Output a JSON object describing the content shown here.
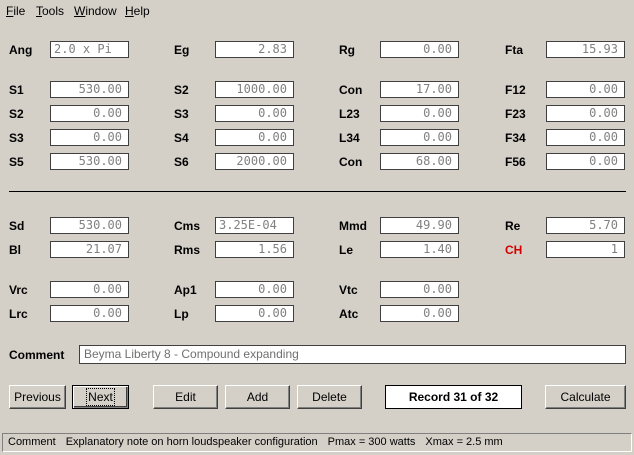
{
  "menu": [
    "File",
    "Tools",
    "Window",
    "Help"
  ],
  "fields": {
    "ang": {
      "label": "Ang",
      "value": "2.0 x Pi"
    },
    "eg": {
      "label": "Eg",
      "value": "2.83"
    },
    "rg": {
      "label": "Rg",
      "value": "0.00"
    },
    "fta": {
      "label": "Fta",
      "value": "15.93"
    },
    "s1": {
      "label": "S1",
      "value": "530.00"
    },
    "s2a": {
      "label": "S2",
      "value": "1000.00"
    },
    "con1": {
      "label": "Con",
      "value": "17.00"
    },
    "f12": {
      "label": "F12",
      "value": "0.00"
    },
    "s2b": {
      "label": "S2",
      "value": "0.00"
    },
    "s3a": {
      "label": "S3",
      "value": "0.00"
    },
    "l23": {
      "label": "L23",
      "value": "0.00"
    },
    "f23": {
      "label": "F23",
      "value": "0.00"
    },
    "s3b": {
      "label": "S3",
      "value": "0.00"
    },
    "s4": {
      "label": "S4",
      "value": "0.00"
    },
    "l34": {
      "label": "L34",
      "value": "0.00"
    },
    "f34": {
      "label": "F34",
      "value": "0.00"
    },
    "s5": {
      "label": "S5",
      "value": "530.00"
    },
    "s6": {
      "label": "S6",
      "value": "2000.00"
    },
    "con2": {
      "label": "Con",
      "value": "68.00"
    },
    "f56": {
      "label": "F56",
      "value": "0.00"
    },
    "sd": {
      "label": "Sd",
      "value": "530.00"
    },
    "cms": {
      "label": "Cms",
      "value": "3.25E-04"
    },
    "mmd": {
      "label": "Mmd",
      "value": "49.90"
    },
    "re": {
      "label": "Re",
      "value": "5.70"
    },
    "bl": {
      "label": "Bl",
      "value": "21.07"
    },
    "rms": {
      "label": "Rms",
      "value": "1.56"
    },
    "le": {
      "label": "Le",
      "value": "1.40"
    },
    "ch": {
      "label": "CH",
      "value": "1"
    },
    "vrc": {
      "label": "Vrc",
      "value": "0.00"
    },
    "ap1": {
      "label": "Ap1",
      "value": "0.00"
    },
    "vtc": {
      "label": "Vtc",
      "value": "0.00"
    },
    "lrc": {
      "label": "Lrc",
      "value": "0.00"
    },
    "lp": {
      "label": "Lp",
      "value": "0.00"
    },
    "atc": {
      "label": "Atc",
      "value": "0.00"
    }
  },
  "comment": {
    "label": "Comment",
    "value": "Beyma Liberty 8 - Compound expanding"
  },
  "buttons": {
    "previous": "Previous",
    "next": "Next",
    "edit": "Edit",
    "add": "Add",
    "delete": "Delete",
    "calculate": "Calculate"
  },
  "record": "Record 31 of 32",
  "status": {
    "comment_label": "Comment",
    "comment_text": "Explanatory note on horn loudspeaker configuration",
    "pmax": "Pmax = 300 watts",
    "xmax": "Xmax = 2.5 mm"
  },
  "colors": {
    "background": "#d4d0c8",
    "ch_label": "#d40000",
    "field_text": "#808080"
  }
}
